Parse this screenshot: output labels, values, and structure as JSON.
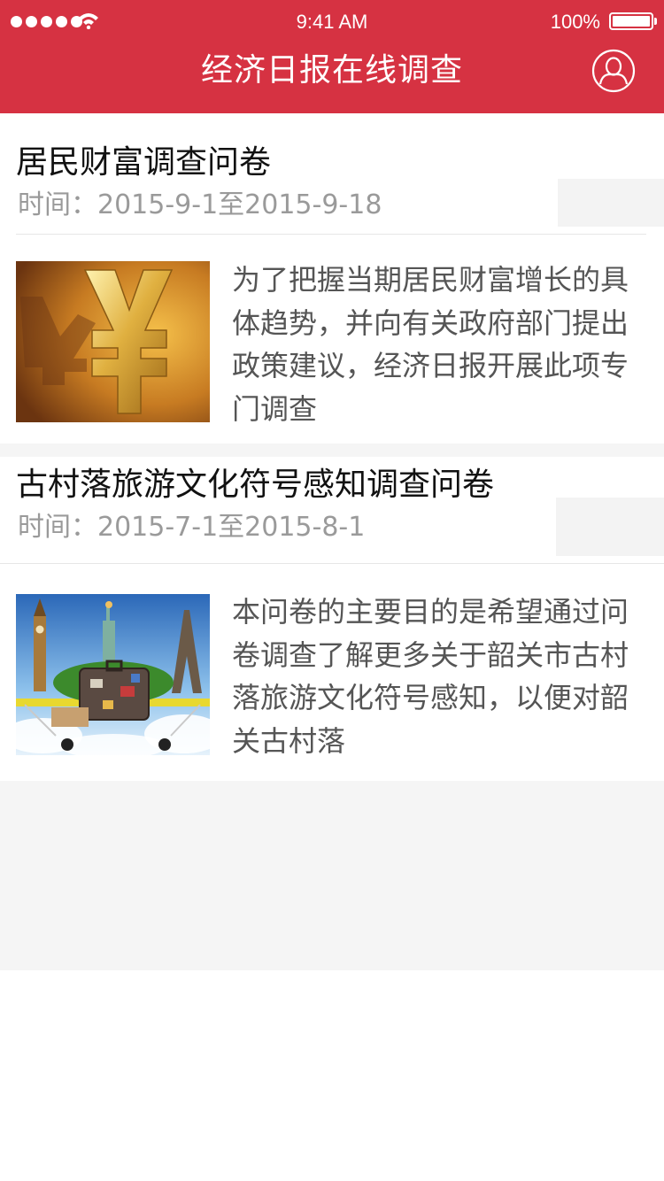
{
  "status_bar": {
    "time": "9:41 AM",
    "battery": "100%"
  },
  "header": {
    "title": "经济日报在线调查",
    "user_icon": "user-circle-icon"
  },
  "surveys": [
    {
      "title": "居民财富调查问卷",
      "date": "时间：2015-9-1至2015-9-18",
      "image": "gold-yuan-symbol",
      "description": "为了把握当期居民财富增长的具体趋势，并向有关政府部门提出政策建议，经济日报开展此项专门调查"
    },
    {
      "title": "古村落旅游文化符号感知调查问卷",
      "date": "时间：2015-7-1至2015-8-1",
      "image": "travel-suitcase-landmarks",
      "description": "本问卷的主要目的是希望通过问卷调查了解更多关于韶关市古村落旅游文化符号感知，以便对韶关古村落"
    }
  ],
  "colors": {
    "brand_red": "#d63242",
    "page_bg": "#f5f5f5",
    "meta_gray": "#9a9a9a"
  }
}
